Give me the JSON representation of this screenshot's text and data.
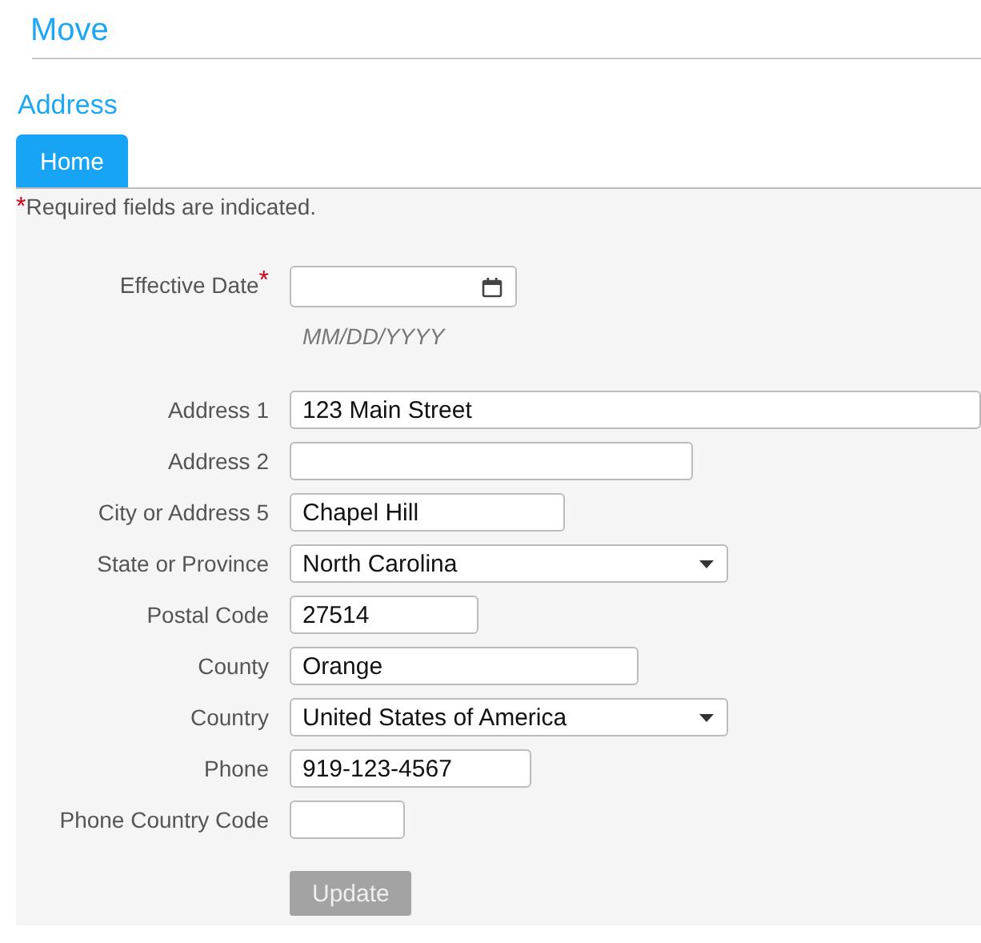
{
  "page_title": "Move",
  "section_title": "Address",
  "tabs": [
    {
      "label": "Home",
      "selected": true
    }
  ],
  "required_note": {
    "mark": "*",
    "text": "Required fields are indicated."
  },
  "fields": [
    {
      "kind": "date",
      "label": "Effective Date",
      "required": true,
      "hint": "MM/DD/YYYY"
    },
    {
      "kind": "text",
      "label": "Address 1",
      "required": false,
      "value": "123 Main Street"
    },
    {
      "kind": "text",
      "label": "Address 2",
      "required": false
    },
    {
      "kind": "text",
      "label": "City or Address 5",
      "required": false,
      "value": "Chapel Hill"
    },
    {
      "kind": "select",
      "label": "State or Province",
      "required": false,
      "value": "North Carolina"
    },
    {
      "kind": "text",
      "label": "Postal Code",
      "required": false,
      "value": "27514"
    },
    {
      "kind": "text",
      "label": "County",
      "required": false,
      "value": "Orange"
    },
    {
      "kind": "select",
      "label": "Country",
      "required": false,
      "value": "United States of America"
    },
    {
      "kind": "text",
      "label": "Phone",
      "required": false,
      "value": "919-123-4567"
    },
    {
      "kind": "text",
      "label": "Phone Country Code",
      "required": false
    }
  ],
  "update_button": {
    "label": "Update",
    "disabled": true
  }
}
